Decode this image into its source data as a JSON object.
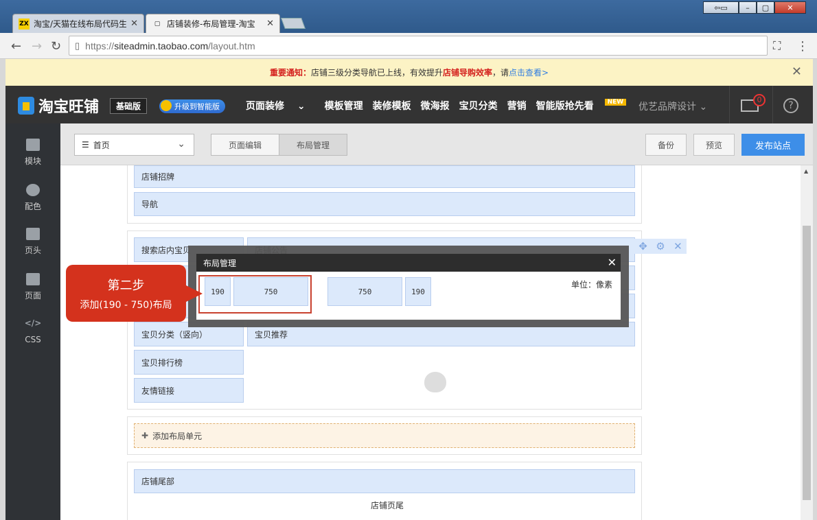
{
  "browser": {
    "tabs": [
      {
        "title": "淘宝/天猫在线布局代码生",
        "favicon": "ZX"
      },
      {
        "title": "店铺装修-布局管理-淘宝"
      }
    ],
    "url_scheme": "https://",
    "url_host": "siteadmin.taobao.com",
    "url_path": "/layout.htm"
  },
  "notice": {
    "label": "重要通知：",
    "text1": "店铺三级分类导航已上线，有效提升",
    "highlight": "店铺导购效率",
    "text2": "，请",
    "link": "点击查看>"
  },
  "topnav": {
    "logo": "淘宝旺铺",
    "edition": "基础版",
    "upgrade": "升级到智能版",
    "menu": [
      "页面装修",
      "模板管理",
      "装修模板",
      "微海报",
      "宝贝分类",
      "营销",
      "智能版抢先看"
    ],
    "menu_dropdown": "⌄",
    "new_badge": "NEW",
    "shop_name": "优艺品牌设计",
    "mail_count": "0",
    "help": "?"
  },
  "sidebar": [
    "模块",
    "配色",
    "页头",
    "页面",
    "CSS"
  ],
  "workbar": {
    "page_select": "首页",
    "seg_edit": "页面编辑",
    "seg_layout": "布局管理",
    "backup": "备份",
    "preview": "预览",
    "publish": "发布站点"
  },
  "layout": {
    "header_modules": [
      "店铺招牌",
      "导航"
    ],
    "left_modules": [
      "搜索店内宝贝",
      "宝贝分类（竖向）",
      "宝贝排行榜",
      "友情链接"
    ],
    "right_modules": [
      "店铺公告",
      "宝贝推荐"
    ],
    "add_unit": "添加布局单元",
    "footer_module": "店铺尾部",
    "footer_text": "店铺页尾"
  },
  "dialog": {
    "title": "布局管理",
    "options": [
      "190",
      "750",
      "750",
      "190"
    ],
    "unit": "单位：像素"
  },
  "callout": {
    "title": "第二步",
    "text": "添加(190 - 750)布局"
  }
}
